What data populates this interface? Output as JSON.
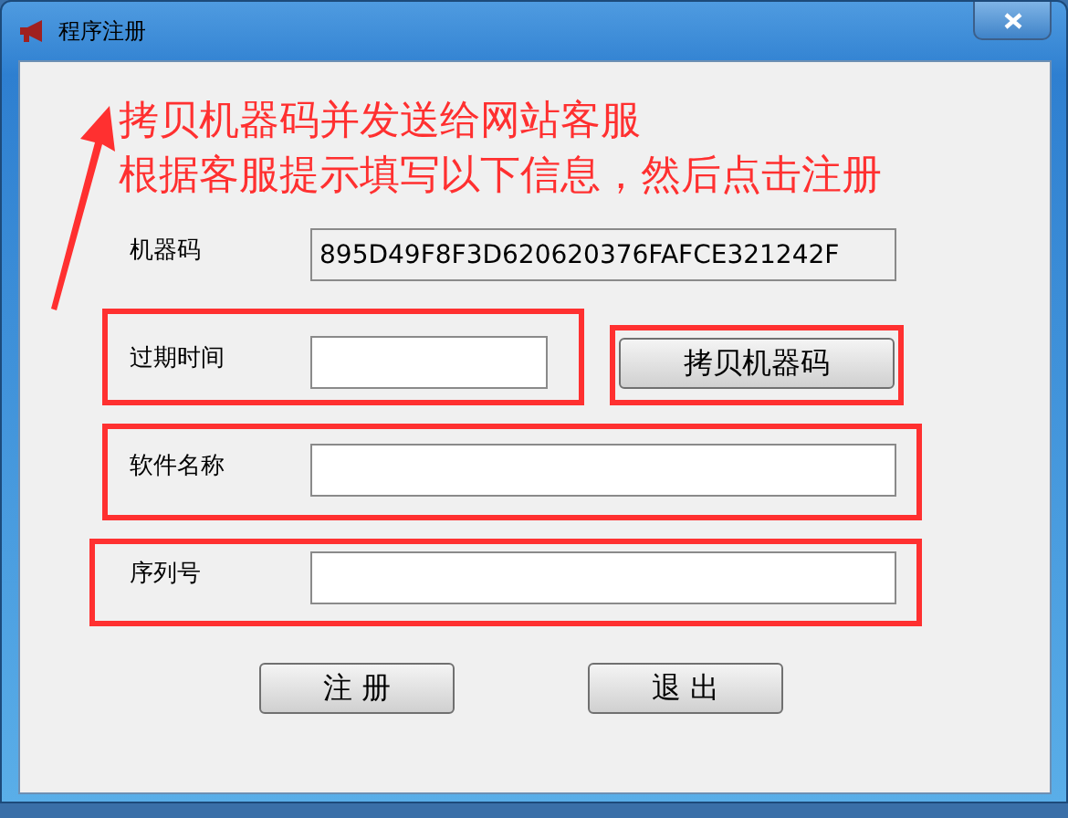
{
  "window": {
    "title": "程序注册"
  },
  "instructions": [
    "拷贝机器码并发送给网站客服",
    "根据客服提示填写以下信息，然后点击注册"
  ],
  "fields": [
    {
      "label": "机器码",
      "value": "895D49F8F3D620620376FAFCE321242F",
      "readonly": true
    },
    {
      "label": "过期时间",
      "readonly": false,
      "action": "拷贝机器码"
    },
    {
      "label": "软件名称",
      "readonly": false
    },
    {
      "label": "序列号",
      "readonly": false
    }
  ],
  "buttons": [
    "注 册",
    "退 出"
  ]
}
